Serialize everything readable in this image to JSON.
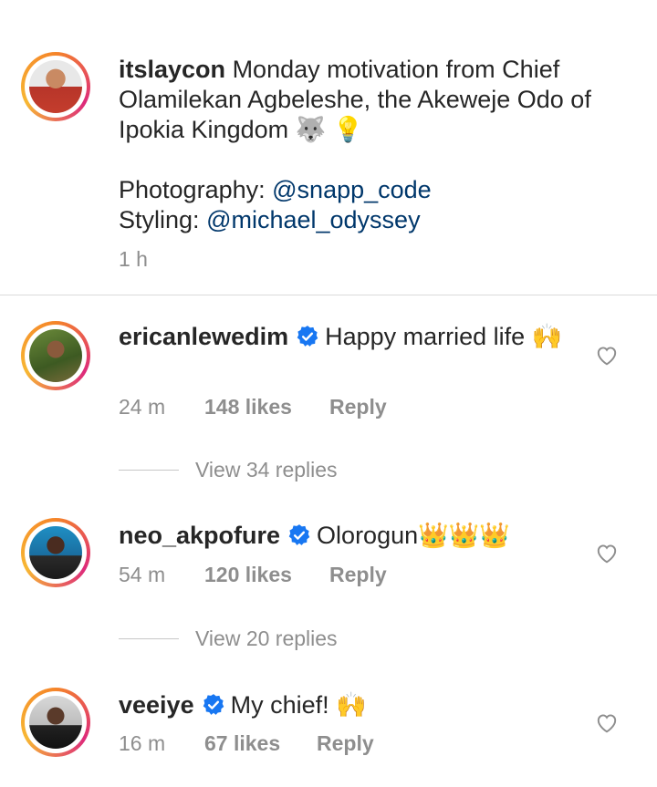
{
  "post": {
    "username": "itslaycon",
    "text": "Monday motivation from Chief Olamilekan Agbeleshe, the Akeweje Odo of Ipokia Kingdom 🐺 💡",
    "photography_label": "Photography:",
    "photography_mention": "@snapp_code",
    "styling_label": "Styling:",
    "styling_mention": "@michael_odyssey",
    "time": "1 h"
  },
  "comments": [
    {
      "username": "ericanlewedim",
      "verified": true,
      "text": "Happy married life 🙌",
      "time": "24 m",
      "likes": "148 likes",
      "reply_label": "Reply",
      "view_replies": "View 34 replies"
    },
    {
      "username": "neo_akpofure",
      "verified": true,
      "text": "Olorogun👑👑👑",
      "time": "54 m",
      "likes": "120 likes",
      "reply_label": "Reply",
      "view_replies": "View 20 replies"
    },
    {
      "username": "veeiye",
      "verified": true,
      "text": "My chief! 🙌",
      "time": "16 m",
      "likes": "67 likes",
      "reply_label": "Reply"
    }
  ],
  "colors": {
    "mention": "#00376b",
    "verified": "#1877f2",
    "secondary_text": "#8e8e8e",
    "divider": "#dbdbdb"
  },
  "icons": {
    "heart": "heart-outline-icon",
    "verified": "verified-badge-icon"
  }
}
